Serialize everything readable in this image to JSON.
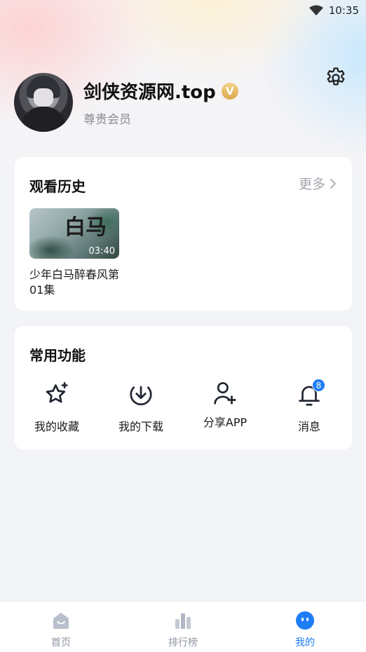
{
  "status_bar": {
    "time": "10:35"
  },
  "profile": {
    "username": "剑侠资源网.top",
    "vip_mark": "V",
    "member_level": "尊贵会员"
  },
  "history": {
    "title": "观看历史",
    "more_label": "更多",
    "items": [
      {
        "thumb_text": "白马",
        "duration": "03:40",
        "name": "少年白马醉春风第01集"
      }
    ]
  },
  "functions": {
    "title": "常用功能",
    "items": [
      {
        "label": "我的收藏",
        "icon": "star-icon"
      },
      {
        "label": "我的下载",
        "icon": "download-icon"
      },
      {
        "label": "分享APP",
        "icon": "add-user-icon"
      },
      {
        "label": "消息",
        "icon": "bell-icon",
        "badge": "8"
      }
    ]
  },
  "tabbar": {
    "tabs": [
      {
        "label": "首页",
        "icon": "home-icon"
      },
      {
        "label": "排行榜",
        "icon": "bar-chart-icon"
      },
      {
        "label": "我的",
        "icon": "profile-face-icon",
        "active": true
      }
    ]
  },
  "colors": {
    "accent": "#1f7df6",
    "vip": "#d9a84e",
    "muted": "#8f95a3"
  }
}
